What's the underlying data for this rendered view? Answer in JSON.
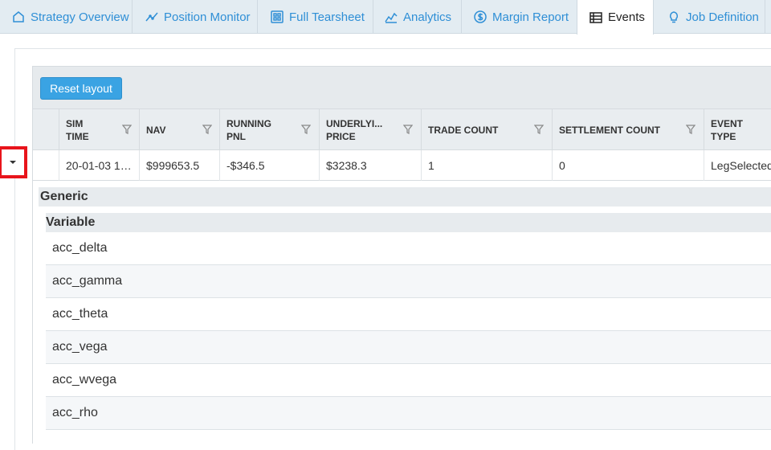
{
  "tabs": [
    {
      "label": "Strategy Overview",
      "icon": "home-icon",
      "active": false
    },
    {
      "label": "Position Monitor",
      "icon": "trend-icon",
      "active": false
    },
    {
      "label": "Full Tearsheet",
      "icon": "grid-icon",
      "active": false
    },
    {
      "label": "Analytics",
      "icon": "analytics-icon",
      "active": false
    },
    {
      "label": "Margin Report",
      "icon": "dollar-icon",
      "active": false
    },
    {
      "label": "Events",
      "icon": "table-icon",
      "active": true
    },
    {
      "label": "Job Definition",
      "icon": "bulb-icon",
      "active": false
    }
  ],
  "toolbar": {
    "reset_label": "Reset layout"
  },
  "columns": [
    "SIM TIME",
    "NAV",
    "RUNNING PNL",
    "UNDERLYI... PRICE",
    "TRADE COUNT",
    "SETTLEMENT COUNT",
    "EVENT TYPE"
  ],
  "row": {
    "sim_time": "20-01-03 1…",
    "nav": "$999653.5",
    "running_pnl": "-$346.5",
    "underlying_price": "$3238.3",
    "trade_count": "1",
    "settlement_count": "0",
    "event_type": "LegSelected"
  },
  "detail": {
    "group": "Generic",
    "subgroup": "Variable",
    "variables": [
      "acc_delta",
      "acc_gamma",
      "acc_theta",
      "acc_vega",
      "acc_wvega",
      "acc_rho"
    ]
  },
  "colors": {
    "accent": "#2f8fd6",
    "button": "#3aa3e3",
    "highlight": "#e8141b"
  }
}
